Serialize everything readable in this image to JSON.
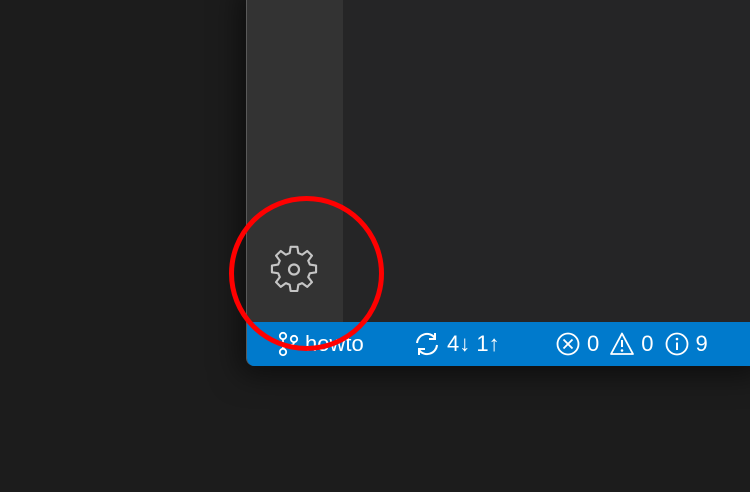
{
  "status_bar": {
    "branch": {
      "icon": "source-control-branch-icon",
      "label": "howto"
    },
    "sync": {
      "icon": "sync-icon",
      "label": "4↓ 1↑"
    },
    "problems": {
      "errors": {
        "icon": "error-icon",
        "count": "0"
      },
      "warnings": {
        "icon": "warning-icon",
        "count": "0"
      },
      "info": {
        "icon": "info-icon",
        "count": "9"
      }
    },
    "background_color": "#007acc"
  },
  "activity_bar": {
    "manage": {
      "icon": "gear-icon"
    }
  },
  "annotation": {
    "color": "#ff0000"
  }
}
